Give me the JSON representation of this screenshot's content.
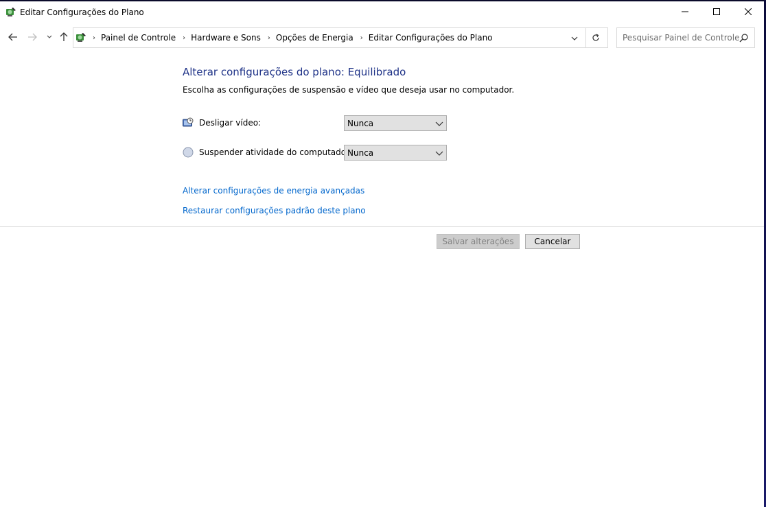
{
  "window": {
    "title": "Editar Configurações do Plano"
  },
  "navigation": {
    "breadcrumbs": [
      "Painel de Controle",
      "Hardware e Sons",
      "Opções de Energia",
      "Editar Configurações do Plano"
    ],
    "search_placeholder": "Pesquisar Painel de Controle"
  },
  "main": {
    "heading": "Alterar configurações do plano: Equilibrado",
    "subtitle": "Escolha as configurações de suspensão e vídeo que deseja usar no computador.",
    "settings": [
      {
        "label": "Desligar vídeo:",
        "value": "Nunca",
        "icon": "display-icon"
      },
      {
        "label": "Suspender atividade do computador:",
        "value": "Nunca",
        "icon": "sleep-moon-icon"
      }
    ],
    "links": [
      "Alterar configurações de energia avançadas",
      "Restaurar configurações padrão deste plano"
    ],
    "buttons": {
      "save": "Salvar alterações",
      "cancel": "Cancelar"
    }
  },
  "colors": {
    "heading": "#1e3287",
    "link": "#0066cc",
    "disabled_text": "#838383"
  }
}
